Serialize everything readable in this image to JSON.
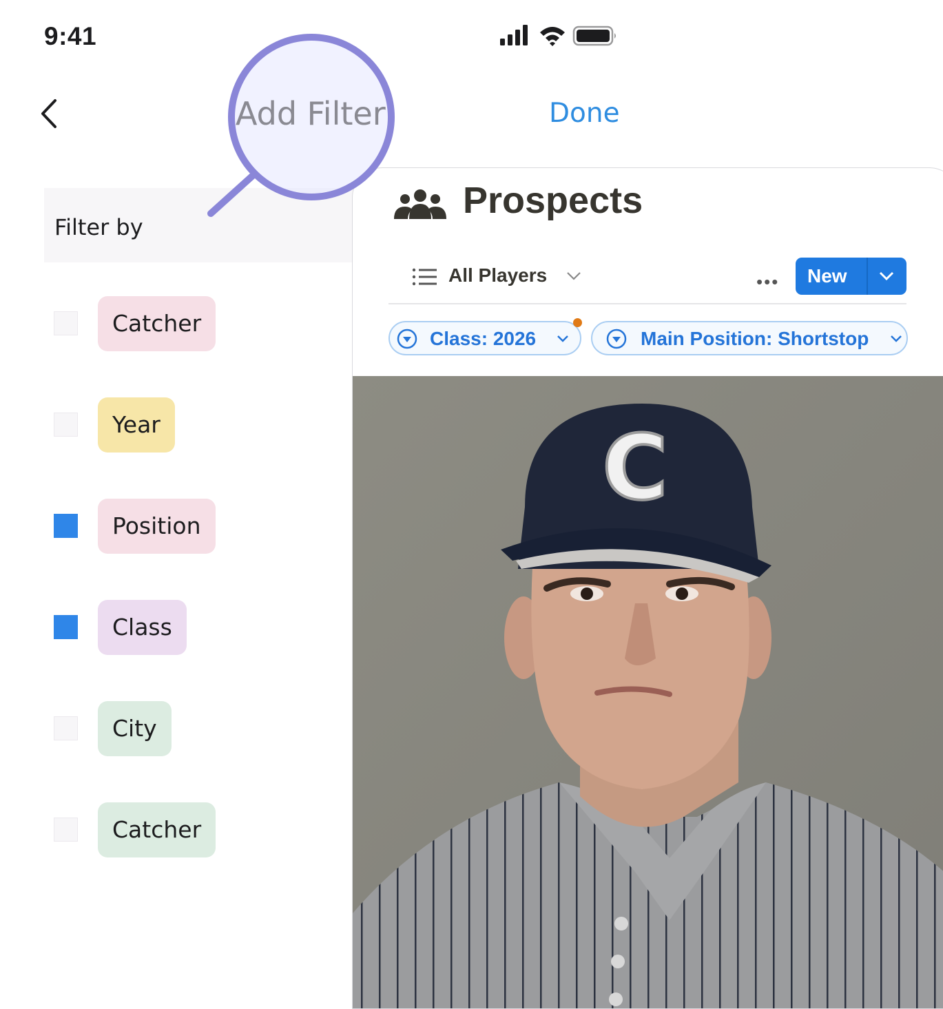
{
  "status_bar": {
    "time": "9:41",
    "icons": [
      "signal-icon",
      "wifi-icon",
      "battery-icon"
    ]
  },
  "nav": {
    "back_icon": "chevron-left-icon",
    "title": "Add Filter",
    "done_label": "Done"
  },
  "magnifier_icon": "magnifier-overlay-icon",
  "filter_header": "Filter by",
  "filters": [
    {
      "label": "Catcher",
      "checked": false,
      "color": "#f6dfe6"
    },
    {
      "label": "Year",
      "checked": false,
      "color": "#f7e6a8"
    },
    {
      "label": "Position",
      "checked": true,
      "color": "#f6dfe6"
    },
    {
      "label": "Class",
      "checked": true,
      "color": "#ecdcf0"
    },
    {
      "label": "City",
      "checked": false,
      "color": "#dcece1"
    },
    {
      "label": "Catcher",
      "checked": false,
      "color": "#dcece1"
    }
  ],
  "preview": {
    "title": "Prospects",
    "title_icon": "people-group-icon",
    "view_name": "All Players",
    "more_icon": "more-horizontal-icon",
    "new_label": "New",
    "chips": [
      {
        "label": "Class: 2026"
      },
      {
        "label": "Main Position: Shortstop"
      }
    ],
    "photo_description_letter": "C"
  },
  "colors": {
    "accent": "#2f8de0",
    "checkbox_on": "#2f86e8",
    "lens": "#8a86d8"
  }
}
